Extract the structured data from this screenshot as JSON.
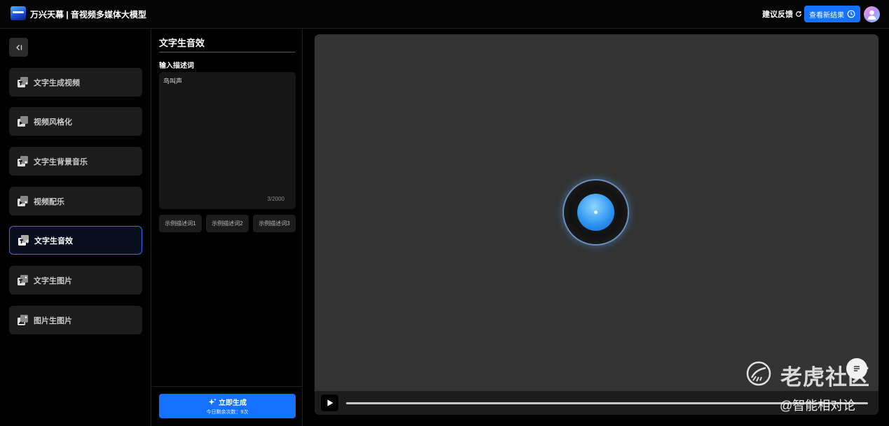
{
  "header": {
    "app_title": "万兴天幕 | 音视频多媒体大模型",
    "feedback_label": "建议反馈",
    "view_results_label": "查看新结果"
  },
  "sidebar": {
    "items": [
      {
        "label": "文字生成视频",
        "icon": "text-video-icon",
        "active": false
      },
      {
        "label": "视频风格化",
        "icon": "video-style-icon",
        "active": false
      },
      {
        "label": "文字生背景音乐",
        "icon": "text-music-icon",
        "active": false
      },
      {
        "label": "视频配乐",
        "icon": "video-music-icon",
        "active": false
      },
      {
        "label": "文字生音效",
        "icon": "text-sound-icon",
        "active": true
      },
      {
        "label": "文字生图片",
        "icon": "text-image-icon",
        "active": false
      },
      {
        "label": "图片生图片",
        "icon": "image-image-icon",
        "active": false
      }
    ]
  },
  "panel": {
    "title": "文字生音效",
    "input_label": "输入描述词",
    "prompt_value": "鸟叫声",
    "char_count": "3/2000",
    "examples": [
      "示例描述词1",
      "示例描述词2",
      "示例描述词3"
    ],
    "generate_label": "立即生成",
    "remaining_label": "今日剩余次数：9次"
  },
  "preview": {
    "progress": 0
  },
  "watermark": {
    "brand": "老虎社区",
    "handle": "@智能相对论"
  },
  "colors": {
    "accent": "#1472ff",
    "active_border": "#2a6dff",
    "preview_bg": "#333333"
  }
}
